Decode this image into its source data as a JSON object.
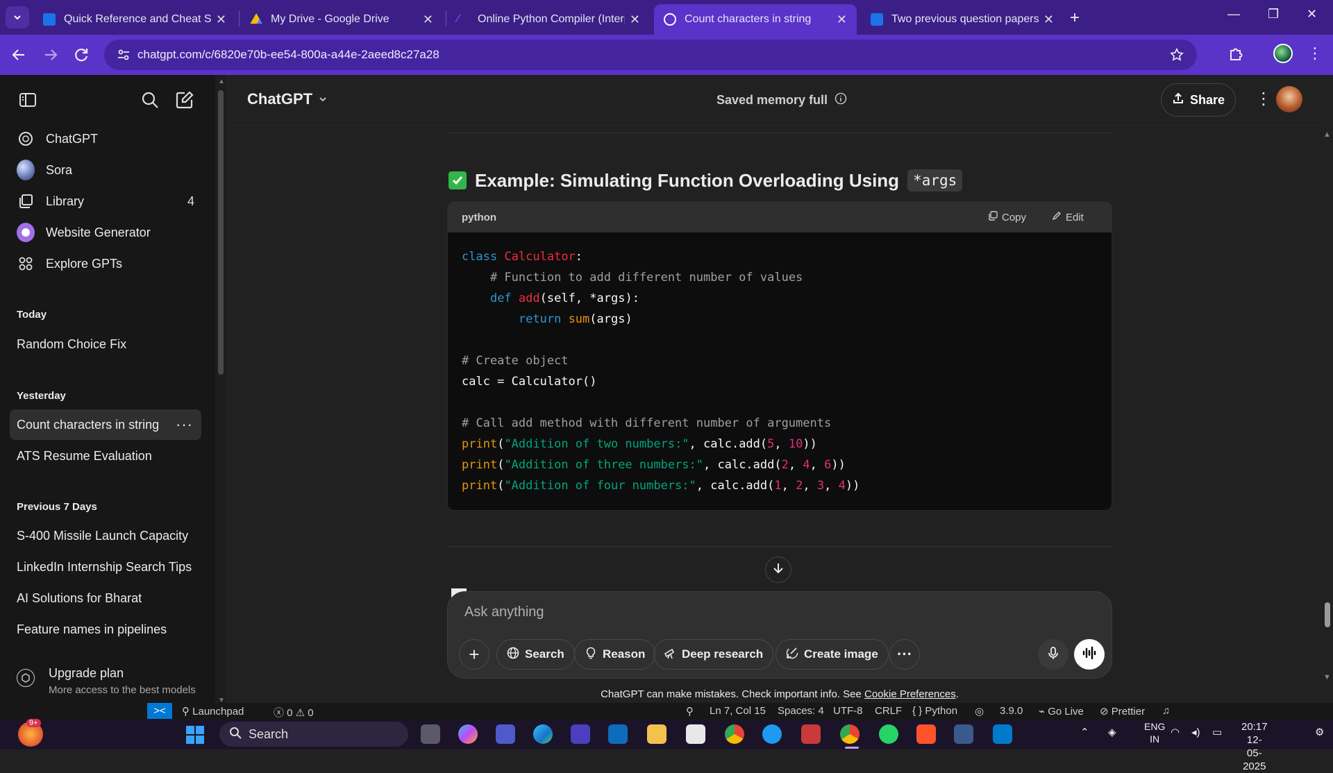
{
  "browser": {
    "tabs": [
      {
        "title": "Quick Reference and Cheat Sheet",
        "favicon_color": "#1a73e8"
      },
      {
        "title": "My Drive - Google Drive",
        "favicon_color": "#fbbc04"
      },
      {
        "title": "Online Python Compiler (Interpreter)",
        "favicon_color": "#8a3ffc"
      },
      {
        "title": "Count characters in string",
        "favicon_color": "#ffffff"
      },
      {
        "title": "Two previous question papers and",
        "favicon_color": "#1a73e8"
      }
    ],
    "active_tab": 3,
    "url": "chatgpt.com/c/6820e70b-ee54-800a-a44e-2aeed8c27a28",
    "accent": "#5a33c9"
  },
  "sidebar": {
    "nav": [
      {
        "label": "ChatGPT",
        "icon": "openai-logo-icon"
      },
      {
        "label": "Sora",
        "icon": "sora-icon"
      },
      {
        "label": "Library",
        "icon": "library-icon",
        "badge": "4"
      },
      {
        "label": "Website Generator",
        "icon": "gpt-icon"
      },
      {
        "label": "Explore GPTs",
        "icon": "grid-icon"
      }
    ],
    "sections": {
      "today": "Today",
      "yesterday": "Yesterday",
      "previous7": "Previous 7 Days"
    },
    "today_chats": [
      "Random Choice Fix"
    ],
    "yesterday_chats": [
      "Count characters in string",
      "ATS Resume Evaluation"
    ],
    "previous7_chats": [
      "S-400 Missile Launch Capacity",
      "LinkedIn Internship Search Tips",
      "AI Solutions for Bharat",
      "Feature names in pipelines"
    ],
    "upgrade_title": "Upgrade plan",
    "upgrade_sub": "More access to the best models"
  },
  "header": {
    "model": "ChatGPT",
    "memory": "Saved memory full",
    "share": "Share"
  },
  "content": {
    "heading_text": "Example: Simulating Function Overloading Using",
    "heading_code": "*args",
    "code_lang": "python",
    "copy": "Copy",
    "edit": "Edit"
  },
  "composer": {
    "placeholder": "Ask anything",
    "buttons": {
      "search": "Search",
      "reason": "Reason",
      "deep_research": "Deep research",
      "create_image": "Create image"
    },
    "disclaimer": "ChatGPT can make mistakes. Check important info. See ",
    "disclaimer_link": "Cookie Preferences",
    "disclaimer_end": "."
  },
  "vscode_status": {
    "launchpad": "Launchpad",
    "problems": "ⓧ 0 ⚠ 0",
    "position": "Ln 7, Col 15",
    "spaces": "Spaces: 4",
    "encoding": "UTF-8",
    "eol": "CRLF",
    "language": "{ } Python",
    "version": "3.9.0",
    "golive": "Go Live",
    "prettier": "Prettier"
  },
  "taskbar": {
    "search": "Search",
    "weather_badge": "9+",
    "lang_top": "ENG",
    "lang_bottom": "IN",
    "time": "20:17",
    "date": "12-05-2025"
  }
}
